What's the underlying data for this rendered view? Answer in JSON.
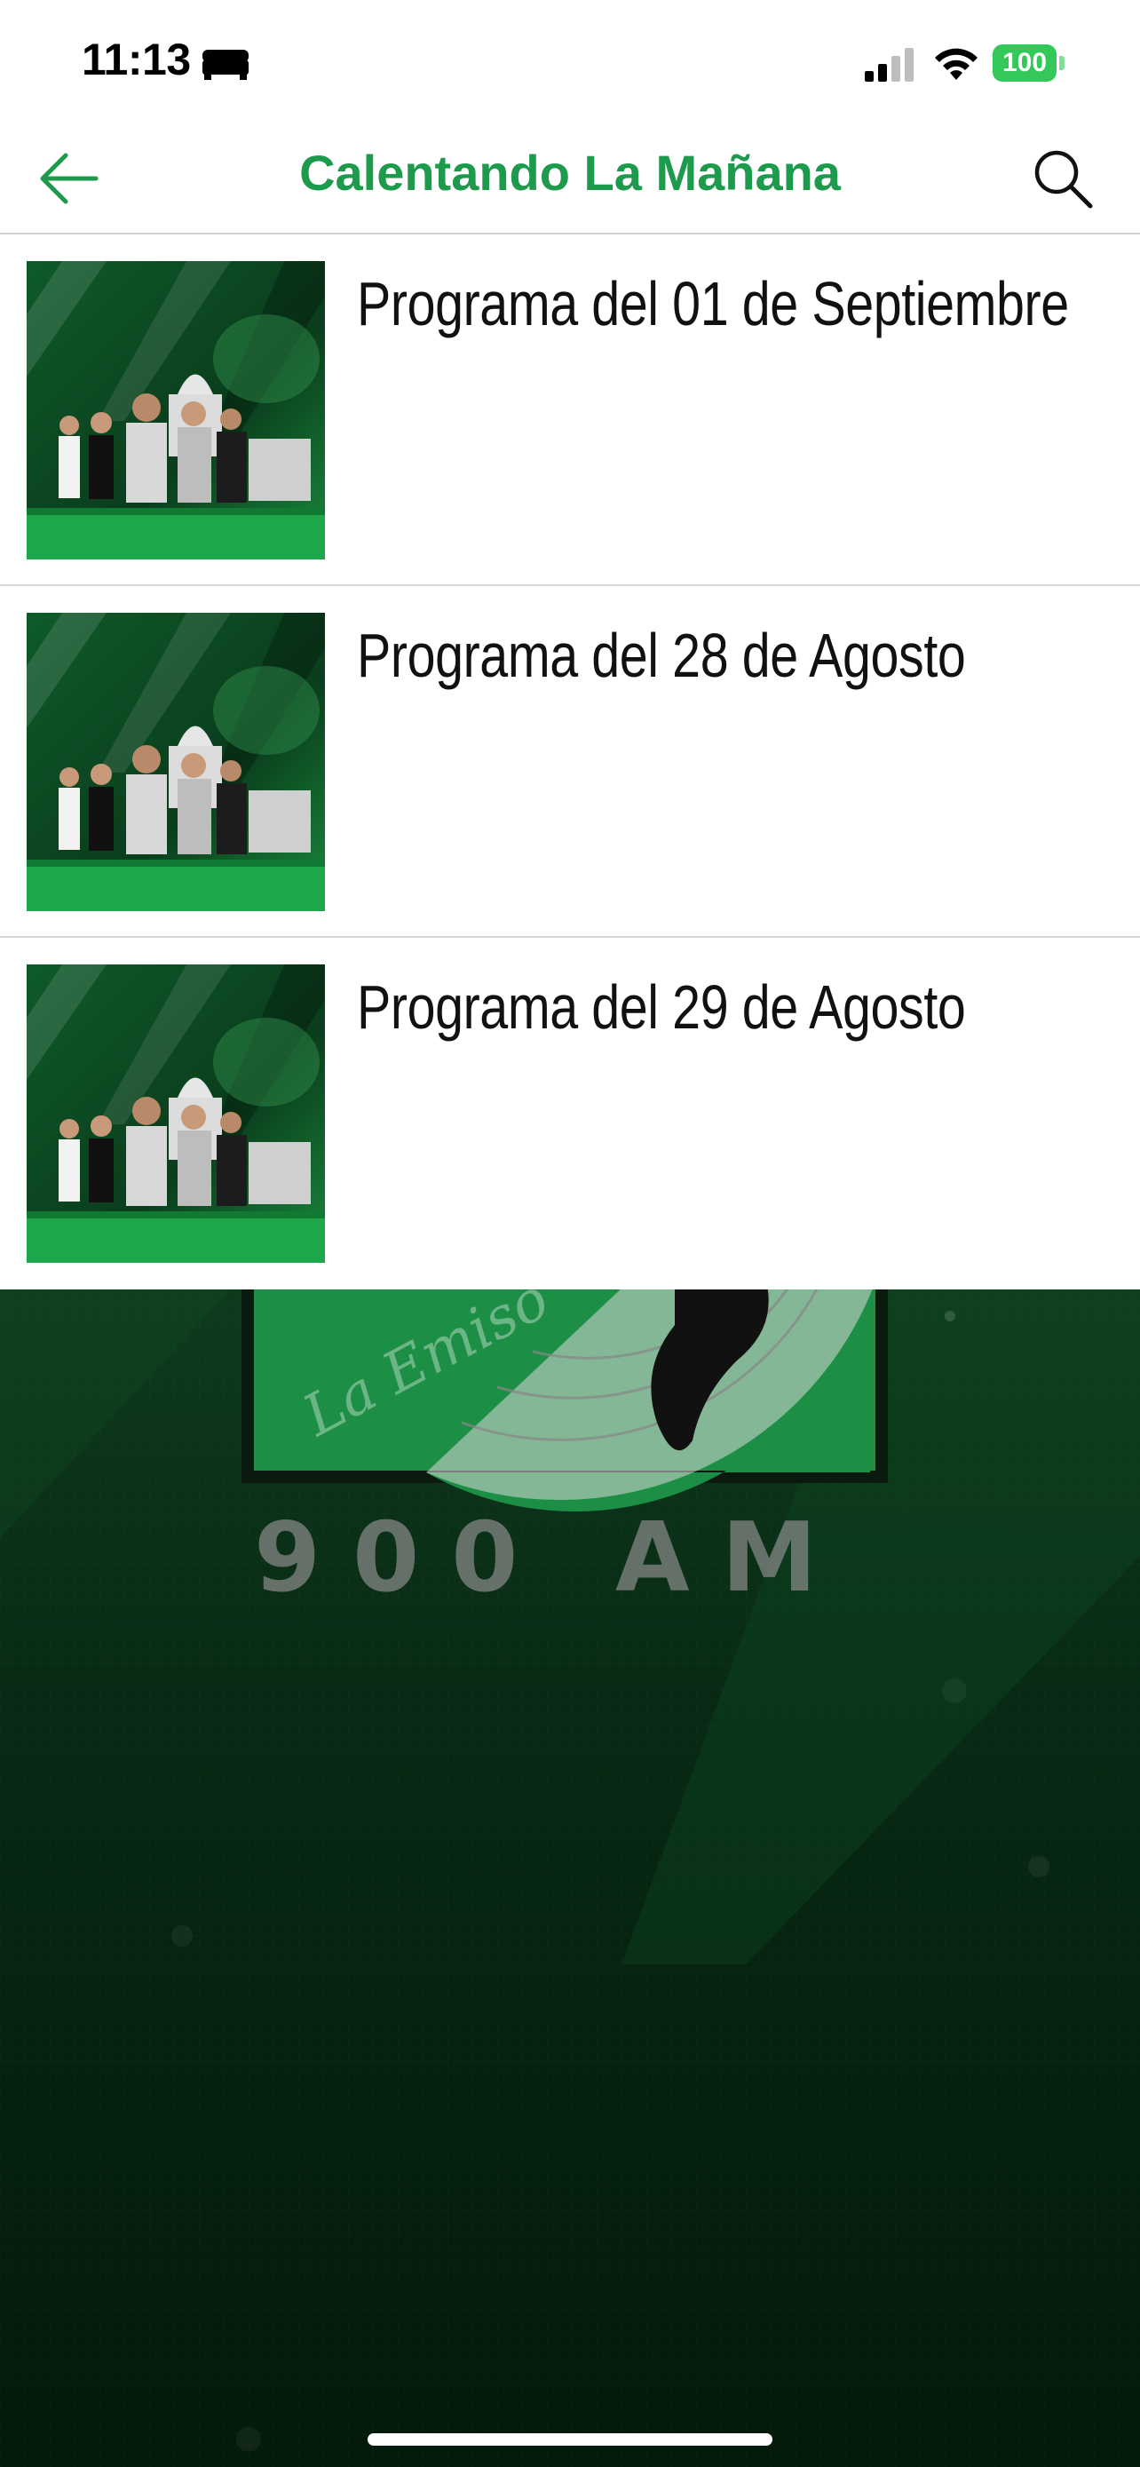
{
  "status_bar": {
    "time": "11:13",
    "battery": "100",
    "icons": [
      "bed-icon",
      "signal-icon",
      "wifi-icon",
      "battery-icon"
    ]
  },
  "nav": {
    "title": "Calentando La Mañana",
    "back_icon": "arrow-left-icon",
    "search_icon": "search-icon"
  },
  "episodes": [
    {
      "title": "Programa del 01 de Septiembre"
    },
    {
      "title": "Programa del 28 de Agosto"
    },
    {
      "title": "Programa del 29 de Agosto"
    }
  ],
  "background": {
    "logo_script": "La Emiso",
    "logo_text": "900 AM"
  },
  "colors": {
    "accent": "#1e9a4c",
    "battery": "#34c759",
    "background_dark": "#082a14"
  }
}
